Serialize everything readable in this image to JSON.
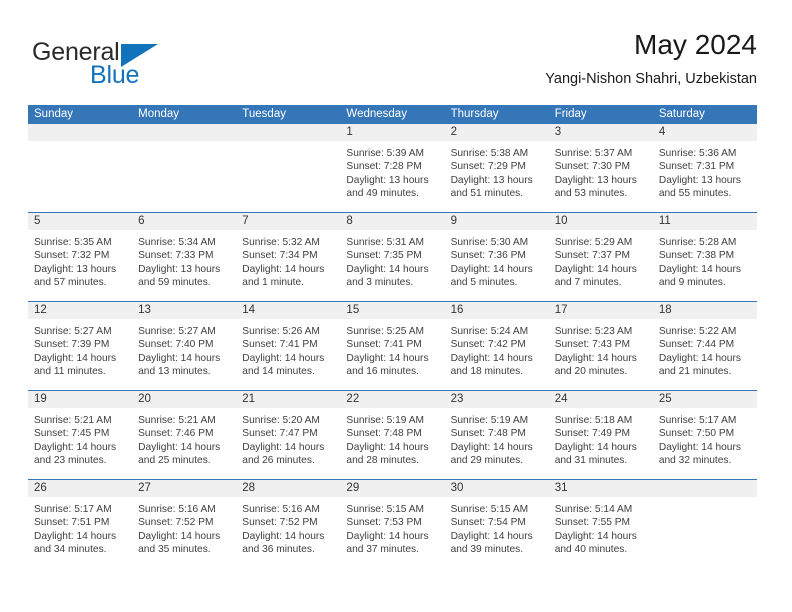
{
  "logo": {
    "word1": "General",
    "word2": "Blue",
    "brand_color": "#1273bd"
  },
  "header": {
    "title": "May 2024",
    "location": "Yangi-Nishon Shahri, Uzbekistan",
    "accent_color": "#3476b8"
  },
  "calendar": {
    "weekday_headers": [
      "Sunday",
      "Monday",
      "Tuesday",
      "Wednesday",
      "Thursday",
      "Friday",
      "Saturday"
    ],
    "labels": {
      "sunrise": "Sunrise:",
      "sunset": "Sunset:",
      "daylight": "Daylight:"
    },
    "weeks": [
      [
        {
          "day": "",
          "sunrise": "",
          "sunset": "",
          "daylight_line1": "",
          "daylight_line2": ""
        },
        {
          "day": "",
          "sunrise": "",
          "sunset": "",
          "daylight_line1": "",
          "daylight_line2": ""
        },
        {
          "day": "",
          "sunrise": "",
          "sunset": "",
          "daylight_line1": "",
          "daylight_line2": ""
        },
        {
          "day": "1",
          "sunrise": "Sunrise: 5:39 AM",
          "sunset": "Sunset: 7:28 PM",
          "daylight_line1": "Daylight: 13 hours",
          "daylight_line2": "and 49 minutes."
        },
        {
          "day": "2",
          "sunrise": "Sunrise: 5:38 AM",
          "sunset": "Sunset: 7:29 PM",
          "daylight_line1": "Daylight: 13 hours",
          "daylight_line2": "and 51 minutes."
        },
        {
          "day": "3",
          "sunrise": "Sunrise: 5:37 AM",
          "sunset": "Sunset: 7:30 PM",
          "daylight_line1": "Daylight: 13 hours",
          "daylight_line2": "and 53 minutes."
        },
        {
          "day": "4",
          "sunrise": "Sunrise: 5:36 AM",
          "sunset": "Sunset: 7:31 PM",
          "daylight_line1": "Daylight: 13 hours",
          "daylight_line2": "and 55 minutes."
        }
      ],
      [
        {
          "day": "5",
          "sunrise": "Sunrise: 5:35 AM",
          "sunset": "Sunset: 7:32 PM",
          "daylight_line1": "Daylight: 13 hours",
          "daylight_line2": "and 57 minutes."
        },
        {
          "day": "6",
          "sunrise": "Sunrise: 5:34 AM",
          "sunset": "Sunset: 7:33 PM",
          "daylight_line1": "Daylight: 13 hours",
          "daylight_line2": "and 59 minutes."
        },
        {
          "day": "7",
          "sunrise": "Sunrise: 5:32 AM",
          "sunset": "Sunset: 7:34 PM",
          "daylight_line1": "Daylight: 14 hours",
          "daylight_line2": "and 1 minute."
        },
        {
          "day": "8",
          "sunrise": "Sunrise: 5:31 AM",
          "sunset": "Sunset: 7:35 PM",
          "daylight_line1": "Daylight: 14 hours",
          "daylight_line2": "and 3 minutes."
        },
        {
          "day": "9",
          "sunrise": "Sunrise: 5:30 AM",
          "sunset": "Sunset: 7:36 PM",
          "daylight_line1": "Daylight: 14 hours",
          "daylight_line2": "and 5 minutes."
        },
        {
          "day": "10",
          "sunrise": "Sunrise: 5:29 AM",
          "sunset": "Sunset: 7:37 PM",
          "daylight_line1": "Daylight: 14 hours",
          "daylight_line2": "and 7 minutes."
        },
        {
          "day": "11",
          "sunrise": "Sunrise: 5:28 AM",
          "sunset": "Sunset: 7:38 PM",
          "daylight_line1": "Daylight: 14 hours",
          "daylight_line2": "and 9 minutes."
        }
      ],
      [
        {
          "day": "12",
          "sunrise": "Sunrise: 5:27 AM",
          "sunset": "Sunset: 7:39 PM",
          "daylight_line1": "Daylight: 14 hours",
          "daylight_line2": "and 11 minutes."
        },
        {
          "day": "13",
          "sunrise": "Sunrise: 5:27 AM",
          "sunset": "Sunset: 7:40 PM",
          "daylight_line1": "Daylight: 14 hours",
          "daylight_line2": "and 13 minutes."
        },
        {
          "day": "14",
          "sunrise": "Sunrise: 5:26 AM",
          "sunset": "Sunset: 7:41 PM",
          "daylight_line1": "Daylight: 14 hours",
          "daylight_line2": "and 14 minutes."
        },
        {
          "day": "15",
          "sunrise": "Sunrise: 5:25 AM",
          "sunset": "Sunset: 7:41 PM",
          "daylight_line1": "Daylight: 14 hours",
          "daylight_line2": "and 16 minutes."
        },
        {
          "day": "16",
          "sunrise": "Sunrise: 5:24 AM",
          "sunset": "Sunset: 7:42 PM",
          "daylight_line1": "Daylight: 14 hours",
          "daylight_line2": "and 18 minutes."
        },
        {
          "day": "17",
          "sunrise": "Sunrise: 5:23 AM",
          "sunset": "Sunset: 7:43 PM",
          "daylight_line1": "Daylight: 14 hours",
          "daylight_line2": "and 20 minutes."
        },
        {
          "day": "18",
          "sunrise": "Sunrise: 5:22 AM",
          "sunset": "Sunset: 7:44 PM",
          "daylight_line1": "Daylight: 14 hours",
          "daylight_line2": "and 21 minutes."
        }
      ],
      [
        {
          "day": "19",
          "sunrise": "Sunrise: 5:21 AM",
          "sunset": "Sunset: 7:45 PM",
          "daylight_line1": "Daylight: 14 hours",
          "daylight_line2": "and 23 minutes."
        },
        {
          "day": "20",
          "sunrise": "Sunrise: 5:21 AM",
          "sunset": "Sunset: 7:46 PM",
          "daylight_line1": "Daylight: 14 hours",
          "daylight_line2": "and 25 minutes."
        },
        {
          "day": "21",
          "sunrise": "Sunrise: 5:20 AM",
          "sunset": "Sunset: 7:47 PM",
          "daylight_line1": "Daylight: 14 hours",
          "daylight_line2": "and 26 minutes."
        },
        {
          "day": "22",
          "sunrise": "Sunrise: 5:19 AM",
          "sunset": "Sunset: 7:48 PM",
          "daylight_line1": "Daylight: 14 hours",
          "daylight_line2": "and 28 minutes."
        },
        {
          "day": "23",
          "sunrise": "Sunrise: 5:19 AM",
          "sunset": "Sunset: 7:48 PM",
          "daylight_line1": "Daylight: 14 hours",
          "daylight_line2": "and 29 minutes."
        },
        {
          "day": "24",
          "sunrise": "Sunrise: 5:18 AM",
          "sunset": "Sunset: 7:49 PM",
          "daylight_line1": "Daylight: 14 hours",
          "daylight_line2": "and 31 minutes."
        },
        {
          "day": "25",
          "sunrise": "Sunrise: 5:17 AM",
          "sunset": "Sunset: 7:50 PM",
          "daylight_line1": "Daylight: 14 hours",
          "daylight_line2": "and 32 minutes."
        }
      ],
      [
        {
          "day": "26",
          "sunrise": "Sunrise: 5:17 AM",
          "sunset": "Sunset: 7:51 PM",
          "daylight_line1": "Daylight: 14 hours",
          "daylight_line2": "and 34 minutes."
        },
        {
          "day": "27",
          "sunrise": "Sunrise: 5:16 AM",
          "sunset": "Sunset: 7:52 PM",
          "daylight_line1": "Daylight: 14 hours",
          "daylight_line2": "and 35 minutes."
        },
        {
          "day": "28",
          "sunrise": "Sunrise: 5:16 AM",
          "sunset": "Sunset: 7:52 PM",
          "daylight_line1": "Daylight: 14 hours",
          "daylight_line2": "and 36 minutes."
        },
        {
          "day": "29",
          "sunrise": "Sunrise: 5:15 AM",
          "sunset": "Sunset: 7:53 PM",
          "daylight_line1": "Daylight: 14 hours",
          "daylight_line2": "and 37 minutes."
        },
        {
          "day": "30",
          "sunrise": "Sunrise: 5:15 AM",
          "sunset": "Sunset: 7:54 PM",
          "daylight_line1": "Daylight: 14 hours",
          "daylight_line2": "and 39 minutes."
        },
        {
          "day": "31",
          "sunrise": "Sunrise: 5:14 AM",
          "sunset": "Sunset: 7:55 PM",
          "daylight_line1": "Daylight: 14 hours",
          "daylight_line2": "and 40 minutes."
        },
        {
          "day": "",
          "sunrise": "",
          "sunset": "",
          "daylight_line1": "",
          "daylight_line2": ""
        }
      ]
    ]
  }
}
